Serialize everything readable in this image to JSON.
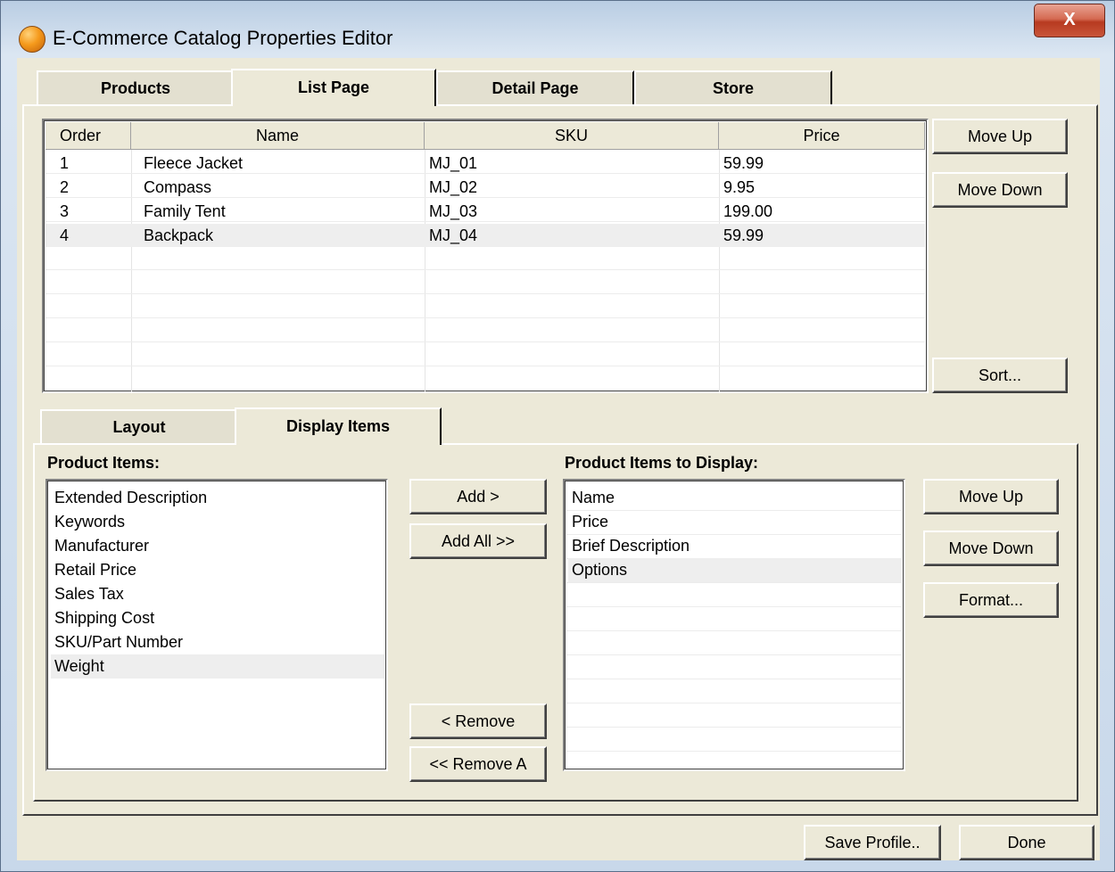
{
  "window": {
    "title": "E-Commerce Catalog Properties Editor",
    "close_label": "X"
  },
  "tabs": [
    {
      "label": "Products"
    },
    {
      "label": "List Page"
    },
    {
      "label": "Detail Page"
    },
    {
      "label": "Store"
    }
  ],
  "grid": {
    "columns": [
      "Order",
      "Name",
      "SKU",
      "Price"
    ],
    "rows": [
      {
        "order": "1",
        "name": "Fleece Jacket",
        "sku": "MJ_01",
        "price": "59.99"
      },
      {
        "order": "2",
        "name": "Compass",
        "sku": "MJ_02",
        "price": "9.95"
      },
      {
        "order": "3",
        "name": "Family Tent",
        "sku": "MJ_03",
        "price": "199.00"
      },
      {
        "order": "4",
        "name": "Backpack",
        "sku": "MJ_04",
        "price": "59.99"
      }
    ],
    "selected_row": 4
  },
  "grid_buttons": {
    "move_up": "Move Up",
    "move_down": "Move Down",
    "sort": "Sort..."
  },
  "subtabs": [
    {
      "label": "Layout"
    },
    {
      "label": "Display Items"
    }
  ],
  "product_items": {
    "label": "Product Items:",
    "items": [
      "Extended Description",
      "Keywords",
      "Manufacturer",
      "Retail Price",
      "Sales Tax",
      "Shipping Cost",
      "SKU/Part Number",
      "Weight"
    ],
    "selected": "Weight"
  },
  "transfer_buttons": {
    "add": "Add >",
    "add_all": "Add All >>",
    "remove": "< Remove",
    "remove_all": "<< Remove A"
  },
  "display_items": {
    "label": "Product Items to Display:",
    "items": [
      "Name",
      "Price",
      "Brief Description",
      "Options"
    ],
    "selected": "Options"
  },
  "display_buttons": {
    "move_up": "Move Up",
    "move_down": "Move Down",
    "format": "Format..."
  },
  "footer": {
    "save_profile": "Save Profile..",
    "done": "Done"
  }
}
